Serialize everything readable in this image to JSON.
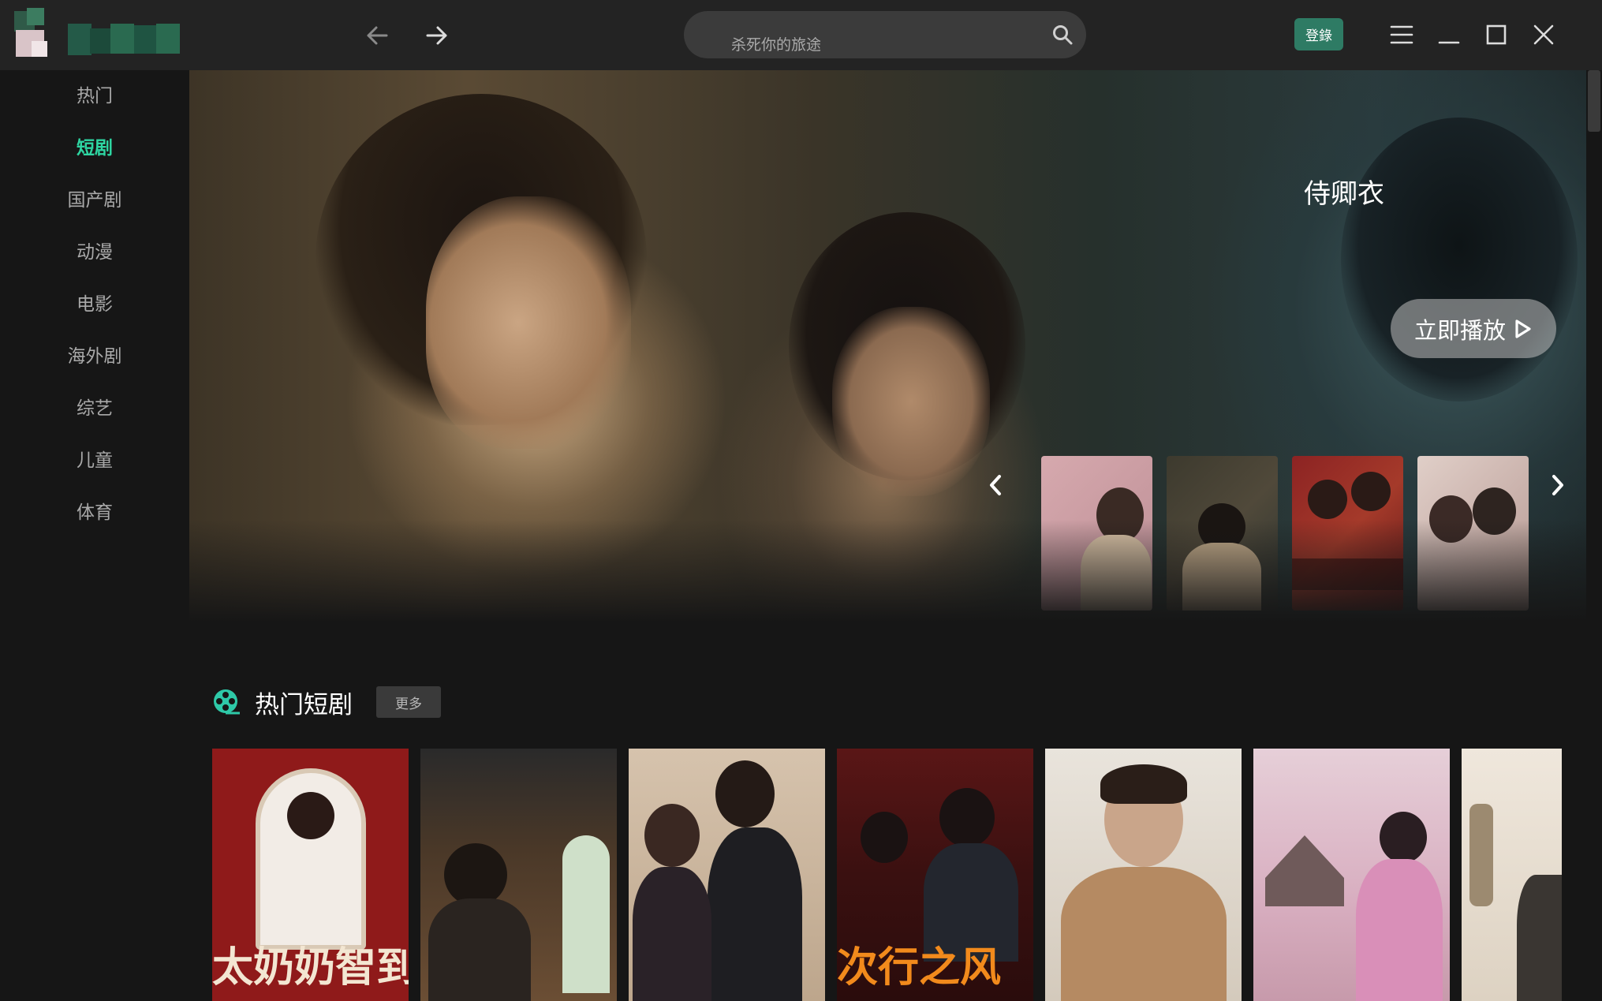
{
  "header": {
    "search_placeholder": "杀死你的旅途",
    "login_label": "登錄"
  },
  "sidebar": {
    "items": [
      {
        "label": "热门"
      },
      {
        "label": "短剧"
      },
      {
        "label": "国产剧"
      },
      {
        "label": "动漫"
      },
      {
        "label": "电影"
      },
      {
        "label": "海外剧"
      },
      {
        "label": "综艺"
      },
      {
        "label": "儿童"
      },
      {
        "label": "体育"
      }
    ],
    "active_index": 1
  },
  "hero": {
    "title": "侍卿衣",
    "play_label": "立即播放"
  },
  "section": {
    "title": "热门短剧",
    "more_label": "更多"
  },
  "cards": [
    {
      "caption": "太奶奶智到",
      "caption_color": "#f3e6d2",
      "bg": "#8f1a1a"
    },
    {
      "caption": "",
      "caption_color": "#f0d58a",
      "bg": "#3a2a1c"
    },
    {
      "caption": "",
      "caption_color": "#ffffff",
      "bg": "#c7b19a"
    },
    {
      "caption": "次行之风",
      "caption_color": "#f28a1c",
      "bg": "#4a1414"
    },
    {
      "caption": "",
      "caption_color": "#ffffff",
      "bg": "#d7cfc4"
    },
    {
      "caption": "",
      "caption_color": "#ffffff",
      "bg": "#d9b7c6"
    },
    {
      "caption": "",
      "caption_color": "#ffffff",
      "bg": "#e3d8cb"
    }
  ],
  "colors": {
    "accent": "#2ed6a2",
    "login_bg": "#2e7b64",
    "topbar_bg": "#232323",
    "page_bg": "#161616"
  }
}
